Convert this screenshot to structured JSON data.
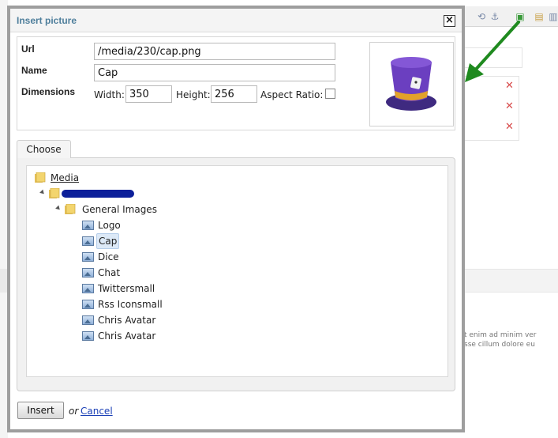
{
  "dialog": {
    "title": "Insert picture",
    "close_symbol": "×"
  },
  "properties": {
    "url_label": "Url",
    "url_value": "/media/230/cap.png",
    "name_label": "Name",
    "name_value": "Cap",
    "dimensions_label": "Dimensions",
    "width_label": "Width:",
    "width_value": "350",
    "height_label": "Height:",
    "height_value": "256",
    "aspect_ratio_label": "Aspect Ratio:",
    "aspect_ratio_checked": false
  },
  "tabs": {
    "choose": "Choose"
  },
  "tree": {
    "root": "Media",
    "folder": "General Images",
    "images": [
      "Logo",
      "Cap",
      "Dice",
      "Chat",
      "Twittersmall",
      "Rss Iconsmall",
      "Chris Avatar",
      "Chris Avatar"
    ],
    "selected": "Cap"
  },
  "actions": {
    "insert": "Insert",
    "or": "or",
    "cancel": "Cancel"
  },
  "background": {
    "text_line_1": "t enim ad minim ver",
    "text_line_2": "sse cillum dolore eu"
  },
  "colors": {
    "title": "#4f7f9c",
    "arrow": "#1f8a1f",
    "link": "#1a3fb6",
    "delete_x": "#d84c4c",
    "selection": "#dce9f7"
  },
  "icons": [
    "close-icon",
    "folder-icon",
    "image-icon",
    "expander-icon",
    "hat-image",
    "delete-icon",
    "anchor-icon",
    "image-toolbar-icon"
  ]
}
